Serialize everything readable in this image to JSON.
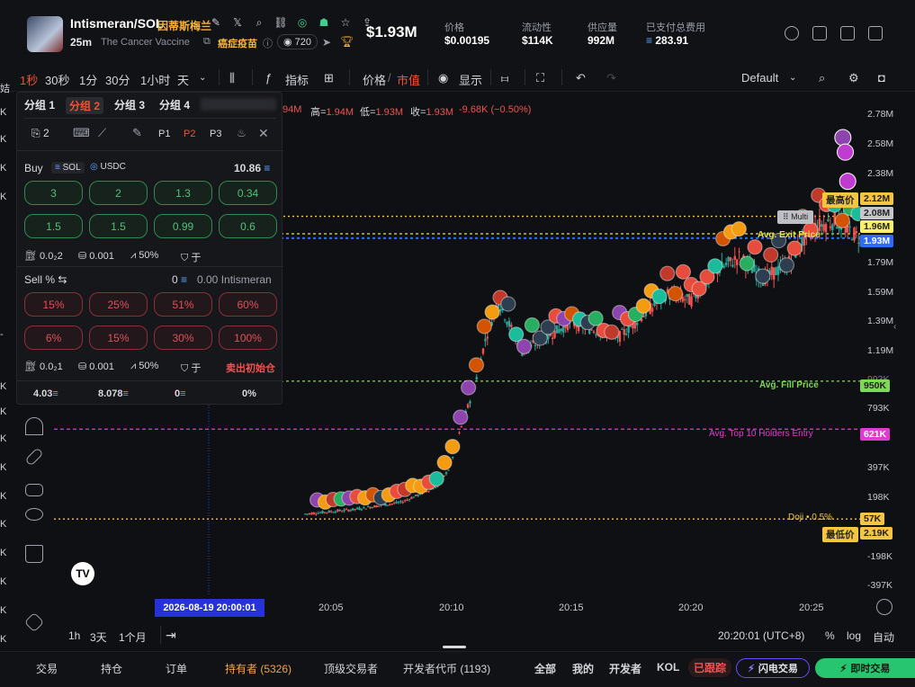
{
  "header": {
    "title": "Intismeran/SOL",
    "title_cn": "因蒂斯梅兰",
    "age": "25m",
    "token_name": "The Cancer Vaccine",
    "tag_cn": "癌症疫苗",
    "holders_icon_count": "720",
    "price": "$1.93M",
    "stats": [
      {
        "label": "价格",
        "value": "$0.00195"
      },
      {
        "label": "流动性",
        "value": "$114K"
      },
      {
        "label": "供应量",
        "value": "992M"
      },
      {
        "label": "已支付总费用",
        "value": "283.91"
      }
    ]
  },
  "toolbar": {
    "intervals": [
      "1秒",
      "30秒",
      "1分",
      "30分",
      "1小时",
      "天"
    ],
    "indicators": "指标",
    "price_label": "价格",
    "mcap_label": "市值",
    "display": "显示",
    "layout": "Default"
  },
  "panel": {
    "groups": [
      "分组 1",
      "分组 2",
      "分组 3",
      "分组 4"
    ],
    "sub": {
      "count": "2",
      "p1": "P1",
      "p2": "P2",
      "p3": "P3"
    },
    "buy": {
      "label": "Buy",
      "sol": "SOL",
      "usdc": "USDC",
      "balance": "10.86",
      "amounts": [
        "3",
        "2",
        "1.3",
        "0.34",
        "1.5",
        "1.5",
        "0.99",
        "0.6"
      ],
      "fee": "0.0₂2",
      "tip": "0.001",
      "slip": "50%",
      "mev": "于"
    },
    "sell": {
      "label": "Sell %",
      "balance": "0",
      "token_balance": "0.00 Intismeran",
      "percents": [
        "15%",
        "25%",
        "51%",
        "60%",
        "6%",
        "15%",
        "30%",
        "100%"
      ],
      "fee": "0.0₂1",
      "tip": "0.001",
      "slip": "50%",
      "mev": "于",
      "sell_init": "卖出初始仓"
    },
    "footer": [
      "4.03",
      "8.078",
      "0",
      "0%"
    ]
  },
  "ohlc": {
    "tail": "94M",
    "high_label": "高=",
    "high": "1.94M",
    "low_label": "低=",
    "low": "1.93M",
    "close_label": "收=",
    "close": "1.93M",
    "change": "-9.68K (−0.50%)"
  },
  "chart_data": {
    "type": "candlestick",
    "x_ticks": [
      "20:05",
      "20:10",
      "20:15",
      "20:20",
      "20:25"
    ],
    "y_ticks": [
      "2.78M",
      "2.58M",
      "2.38M",
      "1.79M",
      "1.59M",
      "1.39M",
      "1.19M",
      "993K",
      "793K",
      "397K",
      "198K",
      "-198K",
      "-397K"
    ],
    "start_label": "2026-08-19  20:00:01",
    "lines": [
      {
        "name": "最高价",
        "value": "2.12M",
        "color": "#f4c542"
      },
      {
        "name": "Avg. Exit Price",
        "value": "1.96M",
        "color": "#e6e34a"
      },
      {
        "name": "current",
        "value": "1.93M",
        "color": "#2f6cf6"
      },
      {
        "name": "Avg. Fill Price",
        "value": "950K",
        "color": "#7ed957"
      },
      {
        "name": "Avg. Top 10 Holders Entry",
        "value": "621K",
        "color": "#e03bd0"
      },
      {
        "name": "Doji • 0.5%",
        "value": "57K",
        "color": "#f4c542"
      },
      {
        "name": "最低价",
        "value": "2.19K",
        "color": "#f4c542"
      }
    ],
    "multi_label": "Multi",
    "multi_value": "2.08M",
    "trend": [
      [
        0,
        30
      ],
      [
        4,
        40
      ],
      [
        6,
        70
      ],
      [
        8,
        120
      ],
      [
        9.5,
        230
      ],
      [
        10,
        360
      ],
      [
        10.5,
        650
      ],
      [
        11,
        900
      ],
      [
        11.5,
        1250
      ],
      [
        12,
        1500
      ],
      [
        13,
        1150
      ],
      [
        14,
        1250
      ],
      [
        15,
        1350
      ],
      [
        16,
        1300
      ],
      [
        17,
        1250
      ],
      [
        18,
        1400
      ],
      [
        19,
        1550
      ],
      [
        20,
        1500
      ],
      [
        21,
        1700
      ],
      [
        22,
        1800
      ],
      [
        23,
        1650
      ],
      [
        24,
        1750
      ],
      [
        25,
        2000
      ],
      [
        26,
        2050
      ],
      [
        27,
        1930
      ]
    ]
  },
  "xaxis_right": {
    "time": "20:20:01 (UTC+8)",
    "pct": "%",
    "log": "log",
    "auto": "自动"
  },
  "range": [
    "1h",
    "3天",
    "1个月"
  ],
  "left_axis": [
    "K",
    "K",
    "K",
    "K",
    "-",
    "K",
    "K",
    "K",
    "K",
    "K",
    "K",
    "K",
    "K",
    "K",
    "K",
    "K",
    "K"
  ],
  "tabs": [
    "交易",
    "持仓",
    "订单",
    "持有者 (5326)",
    "顶级交易者",
    "开发者代币 (1193)"
  ],
  "tabs_right": [
    "全部",
    "我的",
    "开发者",
    "KOL",
    "已跟踪",
    "闪电交易",
    "即时交易"
  ],
  "colors": {
    "up": "#26a69a",
    "down": "#ef5350",
    "accent": "#f0542f",
    "buy": "#50c27c",
    "sell": "#e25059"
  }
}
